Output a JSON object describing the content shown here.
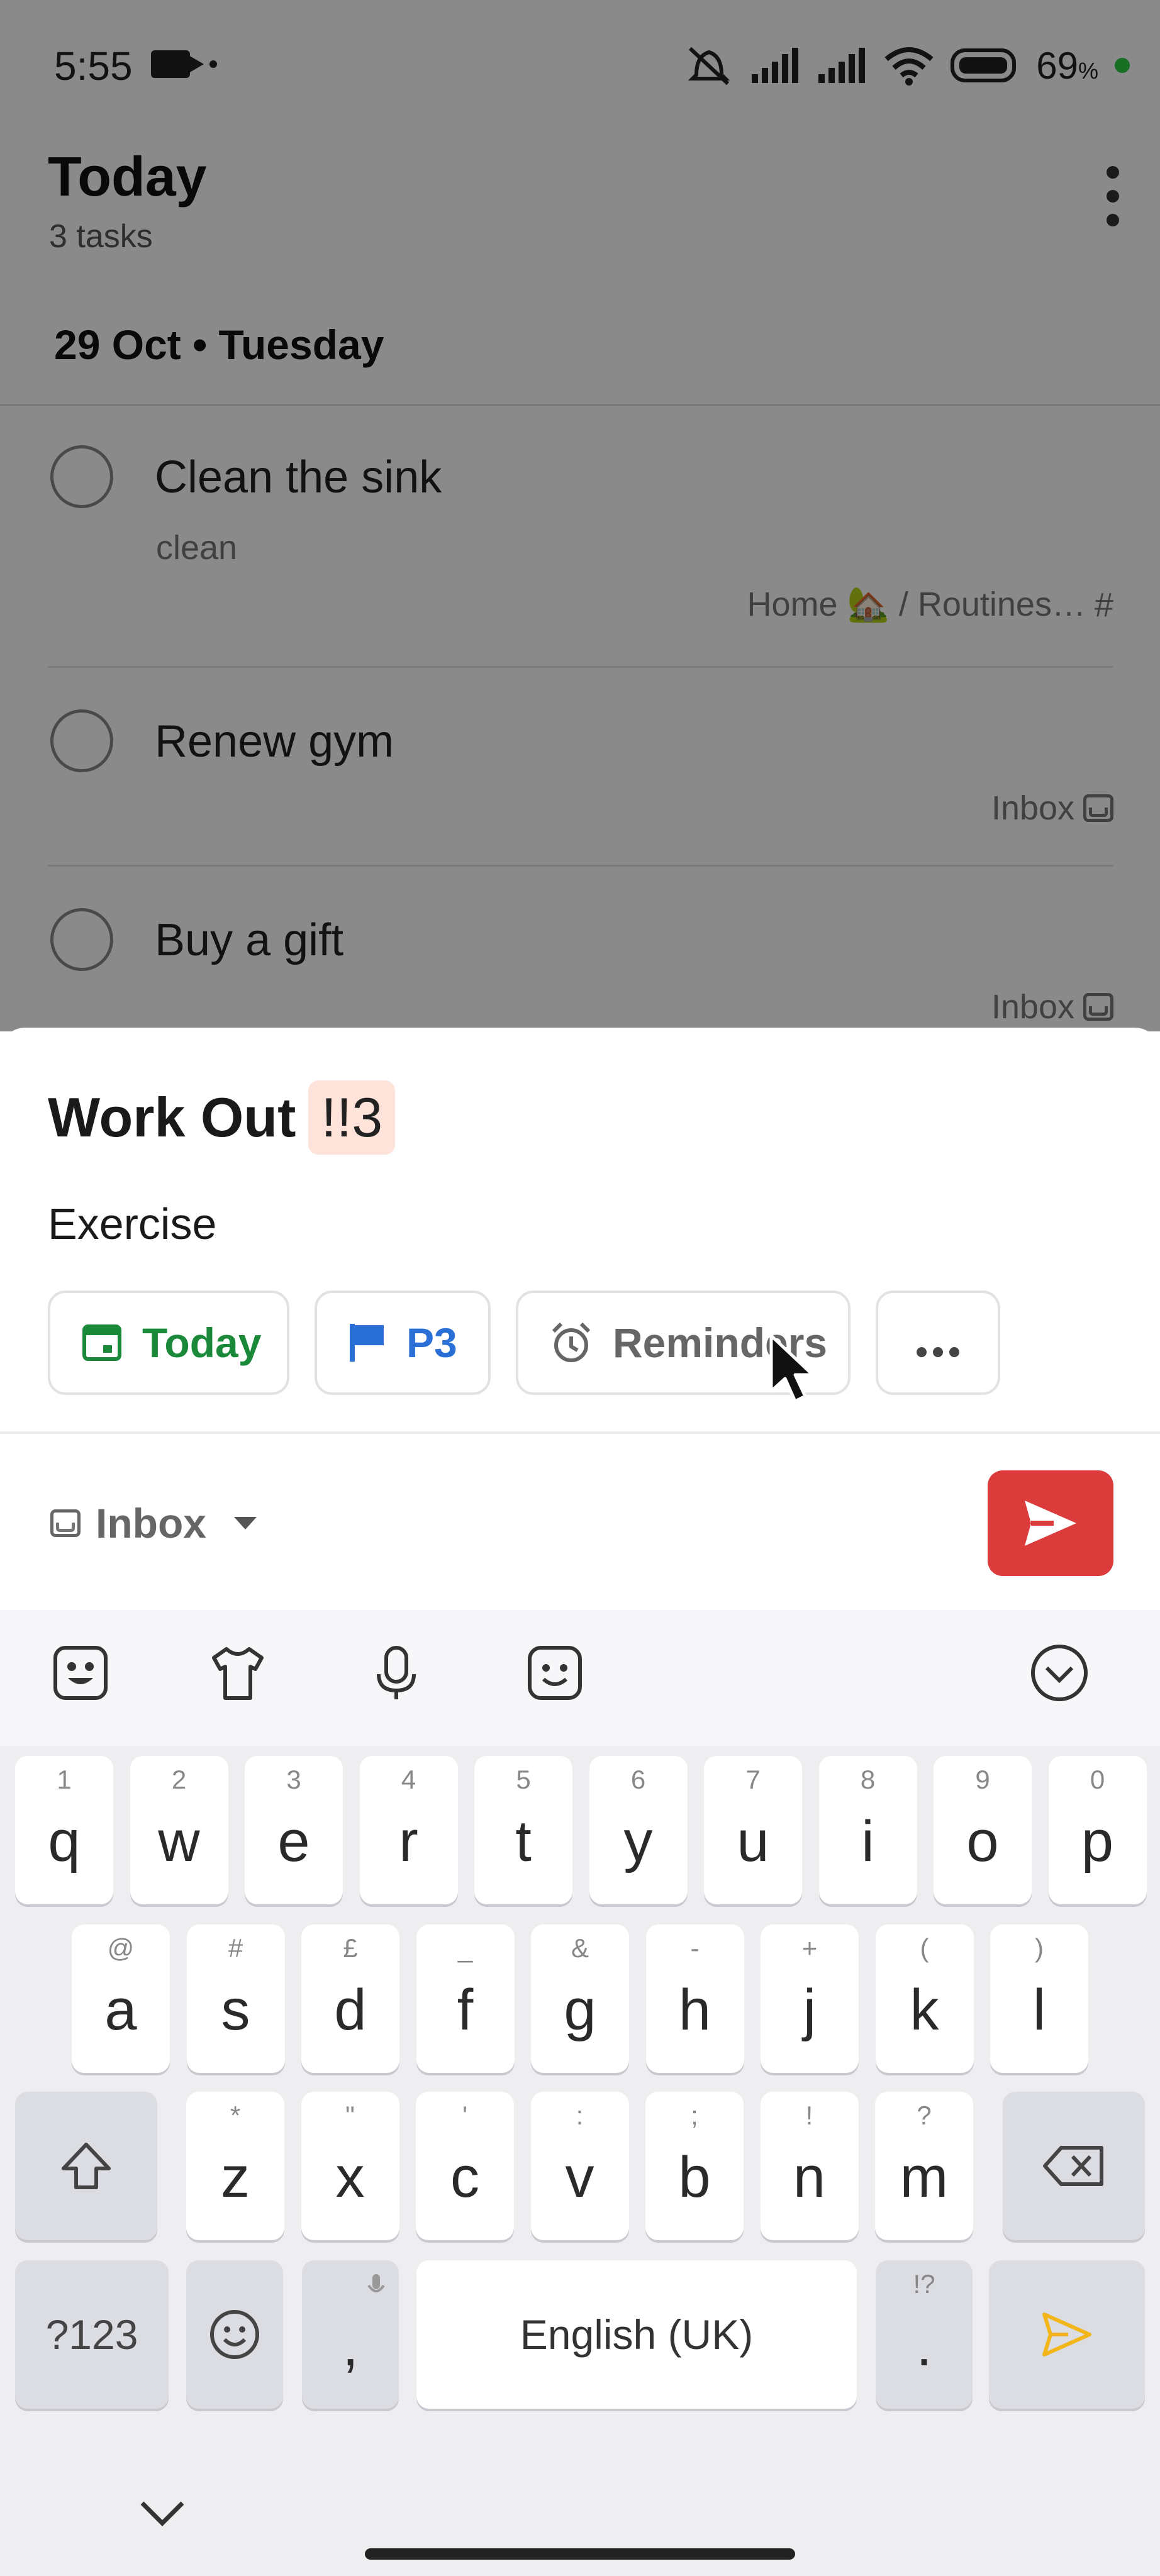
{
  "status_bar": {
    "time": "5:55",
    "battery": "69",
    "battery_unit": "%"
  },
  "header": {
    "title": "Today",
    "subtitle": "3 tasks"
  },
  "section": {
    "date": "29 Oct • Tuesday"
  },
  "tasks": [
    {
      "title": "Clean the sink",
      "description": "clean",
      "project": "Home 🏡 / Routines…",
      "project_icon": "hash-icon"
    },
    {
      "title": "Renew gym",
      "description": "",
      "project": "Inbox",
      "project_icon": "inbox-icon"
    },
    {
      "title": "Buy a gift",
      "description": "",
      "project": "Inbox",
      "project_icon": "inbox-icon"
    }
  ],
  "quick_add": {
    "title": "Work Out",
    "priority_token": "!!3",
    "description": "Exercise",
    "chips": {
      "today": "Today",
      "priority": "P3",
      "reminders": "Reminders"
    },
    "project": "Inbox",
    "colors": {
      "today": "#1a8a3a",
      "priority": "#2a6fd6",
      "send": "#dc3b3b"
    }
  },
  "keyboard": {
    "row1": [
      {
        "num": "1",
        "ch": "q"
      },
      {
        "num": "2",
        "ch": "w"
      },
      {
        "num": "3",
        "ch": "e"
      },
      {
        "num": "4",
        "ch": "r"
      },
      {
        "num": "5",
        "ch": "t"
      },
      {
        "num": "6",
        "ch": "y"
      },
      {
        "num": "7",
        "ch": "u"
      },
      {
        "num": "8",
        "ch": "i"
      },
      {
        "num": "9",
        "ch": "o"
      },
      {
        "num": "0",
        "ch": "p"
      }
    ],
    "row2": [
      {
        "num": "@",
        "ch": "a"
      },
      {
        "num": "#",
        "ch": "s"
      },
      {
        "num": "£",
        "ch": "d"
      },
      {
        "num": "_",
        "ch": "f"
      },
      {
        "num": "&",
        "ch": "g"
      },
      {
        "num": "-",
        "ch": "h"
      },
      {
        "num": "+",
        "ch": "j"
      },
      {
        "num": "(",
        "ch": "k"
      },
      {
        "num": ")",
        "ch": "l"
      }
    ],
    "row3": [
      {
        "num": "*",
        "ch": "z"
      },
      {
        "num": "\"",
        "ch": "x"
      },
      {
        "num": "'",
        "ch": "c"
      },
      {
        "num": ":",
        "ch": "v"
      },
      {
        "num": ";",
        "ch": "b"
      },
      {
        "num": "!",
        "ch": "n"
      },
      {
        "num": "?",
        "ch": "m"
      }
    ],
    "symbols_key": "?123",
    "comma": ",",
    "space": "English (UK)",
    "period": ".",
    "period_hint": "!?"
  }
}
